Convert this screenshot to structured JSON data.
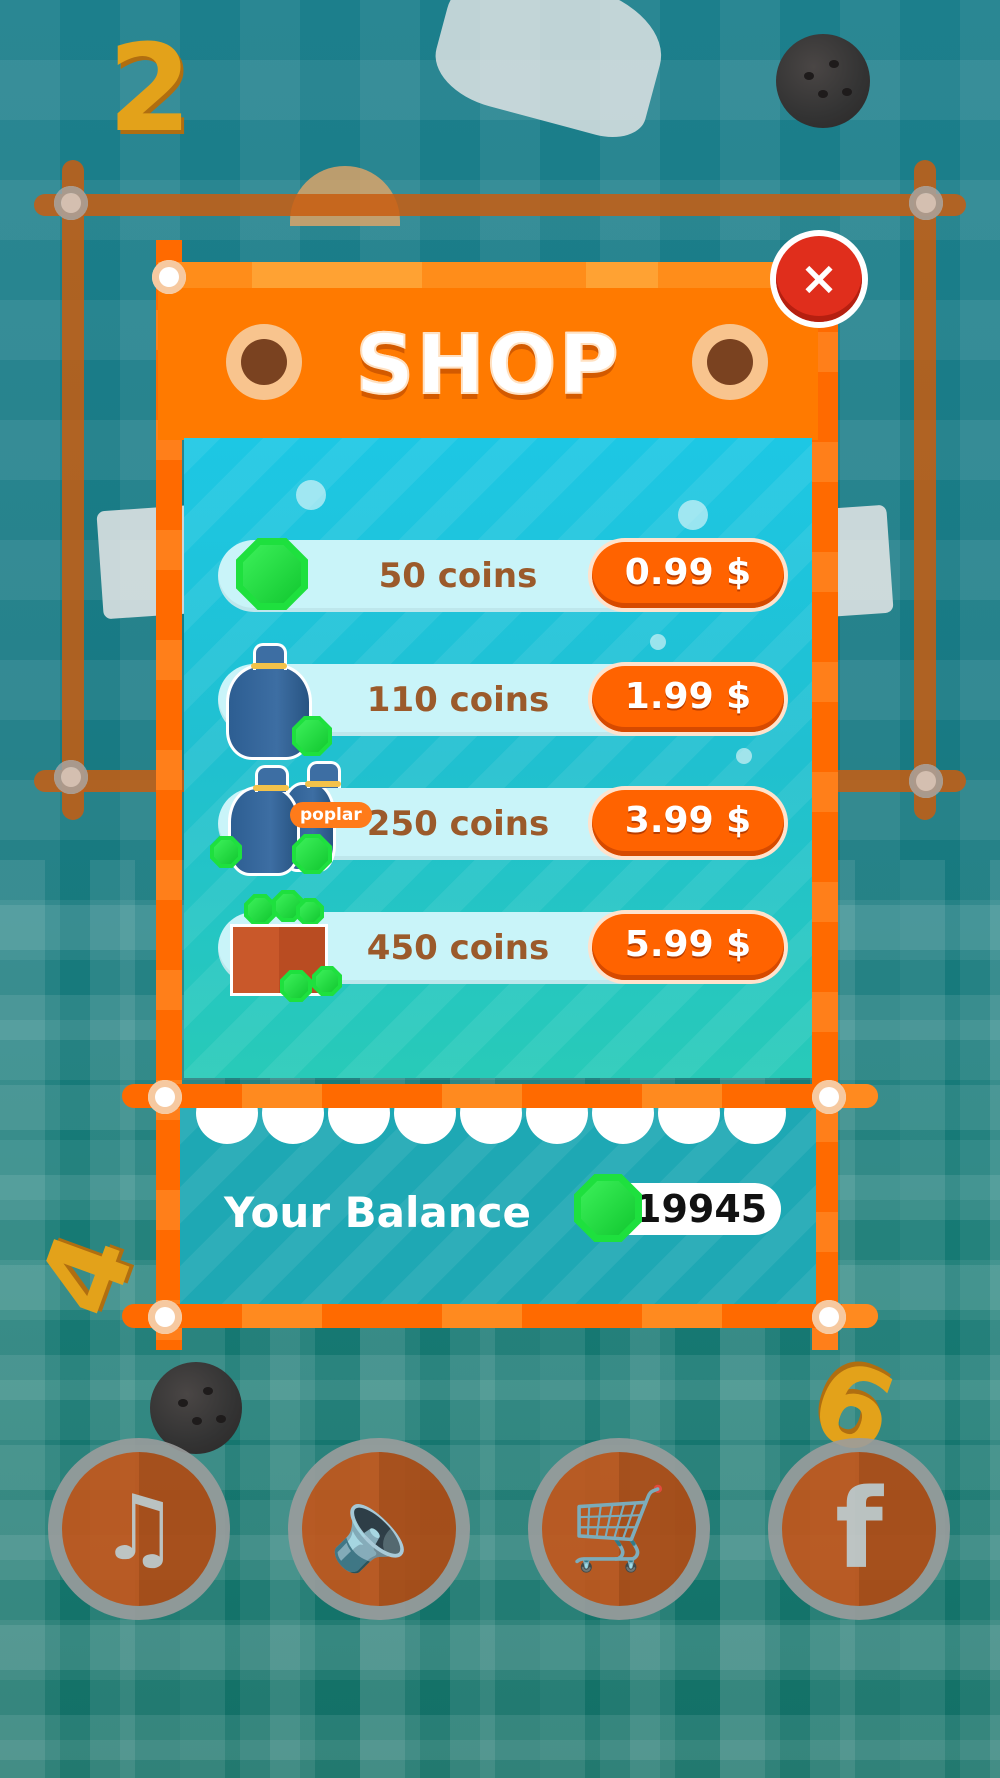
{
  "header": {
    "title": "SHOP"
  },
  "close_button": {
    "label": "×"
  },
  "packages": [
    {
      "coins": "50 coins",
      "price": "0.99 $",
      "icon": "gem-icon"
    },
    {
      "coins": "110 coins",
      "price": "1.99 $",
      "icon": "coin-bag-icon"
    },
    {
      "coins": "250 coins",
      "price": "3.99 $",
      "icon": "double-bag-icon",
      "badge": "poplar"
    },
    {
      "coins": "450 coins",
      "price": "5.99 $",
      "icon": "gem-crate-icon"
    }
  ],
  "balance": {
    "label": "Your Balance",
    "value": "19945",
    "icon": "gem-icon"
  },
  "bottom_buttons": [
    {
      "icon": "music-icon",
      "glyph": "♫"
    },
    {
      "icon": "sound-icon",
      "glyph": "🔈"
    },
    {
      "icon": "cart-icon",
      "glyph": "🛒"
    },
    {
      "icon": "facebook-icon",
      "glyph": "f"
    }
  ],
  "background": {
    "numbers": [
      "2",
      "4",
      "9"
    ]
  },
  "colors": {
    "accent": "#ff7a00",
    "button": "#ff6300",
    "gem": "#1ee03e",
    "label_text": "#9b5a2b",
    "close": "#e02e1c"
  }
}
